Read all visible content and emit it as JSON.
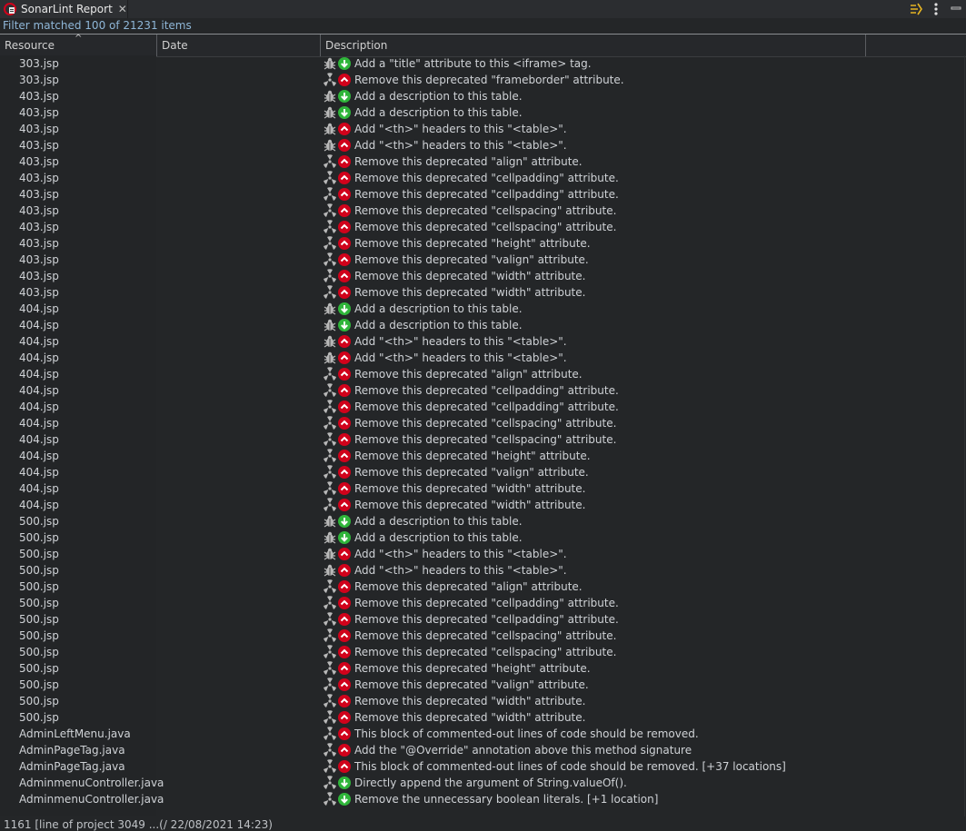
{
  "tab": {
    "title": "SonarLint Report",
    "close_glyph": "✕"
  },
  "toolbar": {
    "filter_icon": "filter-icon",
    "menu_icon": "kebab-menu-icon",
    "minimize_icon": "minimize-icon"
  },
  "filter_summary": "Filter matched 100 of 21231 items",
  "columns": {
    "resource": "Resource",
    "date": "Date",
    "description": "Description"
  },
  "rows": [
    {
      "resource": "303.jsp",
      "severity": "bug",
      "impact": "low",
      "description": "Add a \"title\" attribute to this <iframe> tag."
    },
    {
      "resource": "303.jsp",
      "severity": "code-smell",
      "impact": "high",
      "description": "Remove this deprecated \"frameborder\" attribute."
    },
    {
      "resource": "403.jsp",
      "severity": "bug",
      "impact": "low",
      "description": "Add a description to this table."
    },
    {
      "resource": "403.jsp",
      "severity": "bug",
      "impact": "low",
      "description": "Add a description to this table."
    },
    {
      "resource": "403.jsp",
      "severity": "bug",
      "impact": "high",
      "description": "Add \"<th>\" headers to this \"<table>\"."
    },
    {
      "resource": "403.jsp",
      "severity": "bug",
      "impact": "high",
      "description": "Add \"<th>\" headers to this \"<table>\"."
    },
    {
      "resource": "403.jsp",
      "severity": "code-smell",
      "impact": "high",
      "description": "Remove this deprecated \"align\" attribute."
    },
    {
      "resource": "403.jsp",
      "severity": "code-smell",
      "impact": "high",
      "description": "Remove this deprecated \"cellpadding\" attribute."
    },
    {
      "resource": "403.jsp",
      "severity": "code-smell",
      "impact": "high",
      "description": "Remove this deprecated \"cellpadding\" attribute."
    },
    {
      "resource": "403.jsp",
      "severity": "code-smell",
      "impact": "high",
      "description": "Remove this deprecated \"cellspacing\" attribute."
    },
    {
      "resource": "403.jsp",
      "severity": "code-smell",
      "impact": "high",
      "description": "Remove this deprecated \"cellspacing\" attribute."
    },
    {
      "resource": "403.jsp",
      "severity": "code-smell",
      "impact": "high",
      "description": "Remove this deprecated \"height\" attribute."
    },
    {
      "resource": "403.jsp",
      "severity": "code-smell",
      "impact": "high",
      "description": "Remove this deprecated \"valign\" attribute."
    },
    {
      "resource": "403.jsp",
      "severity": "code-smell",
      "impact": "high",
      "description": "Remove this deprecated \"width\" attribute."
    },
    {
      "resource": "403.jsp",
      "severity": "code-smell",
      "impact": "high",
      "description": "Remove this deprecated \"width\" attribute."
    },
    {
      "resource": "404.jsp",
      "severity": "bug",
      "impact": "low",
      "description": "Add a description to this table."
    },
    {
      "resource": "404.jsp",
      "severity": "bug",
      "impact": "low",
      "description": "Add a description to this table."
    },
    {
      "resource": "404.jsp",
      "severity": "bug",
      "impact": "high",
      "description": "Add \"<th>\" headers to this \"<table>\"."
    },
    {
      "resource": "404.jsp",
      "severity": "bug",
      "impact": "high",
      "description": "Add \"<th>\" headers to this \"<table>\"."
    },
    {
      "resource": "404.jsp",
      "severity": "code-smell",
      "impact": "high",
      "description": "Remove this deprecated \"align\" attribute."
    },
    {
      "resource": "404.jsp",
      "severity": "code-smell",
      "impact": "high",
      "description": "Remove this deprecated \"cellpadding\" attribute."
    },
    {
      "resource": "404.jsp",
      "severity": "code-smell",
      "impact": "high",
      "description": "Remove this deprecated \"cellpadding\" attribute."
    },
    {
      "resource": "404.jsp",
      "severity": "code-smell",
      "impact": "high",
      "description": "Remove this deprecated \"cellspacing\" attribute."
    },
    {
      "resource": "404.jsp",
      "severity": "code-smell",
      "impact": "high",
      "description": "Remove this deprecated \"cellspacing\" attribute."
    },
    {
      "resource": "404.jsp",
      "severity": "code-smell",
      "impact": "high",
      "description": "Remove this deprecated \"height\" attribute."
    },
    {
      "resource": "404.jsp",
      "severity": "code-smell",
      "impact": "high",
      "description": "Remove this deprecated \"valign\" attribute."
    },
    {
      "resource": "404.jsp",
      "severity": "code-smell",
      "impact": "high",
      "description": "Remove this deprecated \"width\" attribute."
    },
    {
      "resource": "404.jsp",
      "severity": "code-smell",
      "impact": "high",
      "description": "Remove this deprecated \"width\" attribute."
    },
    {
      "resource": "500.jsp",
      "severity": "bug",
      "impact": "low",
      "description": "Add a description to this table."
    },
    {
      "resource": "500.jsp",
      "severity": "bug",
      "impact": "low",
      "description": "Add a description to this table."
    },
    {
      "resource": "500.jsp",
      "severity": "bug",
      "impact": "high",
      "description": "Add \"<th>\" headers to this \"<table>\"."
    },
    {
      "resource": "500.jsp",
      "severity": "bug",
      "impact": "high",
      "description": "Add \"<th>\" headers to this \"<table>\"."
    },
    {
      "resource": "500.jsp",
      "severity": "code-smell",
      "impact": "high",
      "description": "Remove this deprecated \"align\" attribute."
    },
    {
      "resource": "500.jsp",
      "severity": "code-smell",
      "impact": "high",
      "description": "Remove this deprecated \"cellpadding\" attribute."
    },
    {
      "resource": "500.jsp",
      "severity": "code-smell",
      "impact": "high",
      "description": "Remove this deprecated \"cellpadding\" attribute."
    },
    {
      "resource": "500.jsp",
      "severity": "code-smell",
      "impact": "high",
      "description": "Remove this deprecated \"cellspacing\" attribute."
    },
    {
      "resource": "500.jsp",
      "severity": "code-smell",
      "impact": "high",
      "description": "Remove this deprecated \"cellspacing\" attribute."
    },
    {
      "resource": "500.jsp",
      "severity": "code-smell",
      "impact": "high",
      "description": "Remove this deprecated \"height\" attribute."
    },
    {
      "resource": "500.jsp",
      "severity": "code-smell",
      "impact": "high",
      "description": "Remove this deprecated \"valign\" attribute."
    },
    {
      "resource": "500.jsp",
      "severity": "code-smell",
      "impact": "high",
      "description": "Remove this deprecated \"width\" attribute."
    },
    {
      "resource": "500.jsp",
      "severity": "code-smell",
      "impact": "high",
      "description": "Remove this deprecated \"width\" attribute."
    },
    {
      "resource": "AdminLeftMenu.java",
      "severity": "code-smell",
      "impact": "high",
      "description": "This block of commented-out lines of code should be removed."
    },
    {
      "resource": "AdminPageTag.java",
      "severity": "code-smell",
      "impact": "high",
      "description": "Add the \"@Override\" annotation above this method signature"
    },
    {
      "resource": "AdminPageTag.java",
      "severity": "code-smell",
      "impact": "high",
      "description": "This block of commented-out lines of code should be removed. [+37 locations]"
    },
    {
      "resource": "AdminmenuController.java",
      "severity": "code-smell",
      "impact": "low",
      "description": "Directly append the argument of String.valueOf()."
    },
    {
      "resource": "AdminmenuController.java",
      "severity": "code-smell",
      "impact": "low",
      "description": "Remove the unnecessary boolean literals. [+1 location]"
    }
  ],
  "status_line": "1161 [line of project 3049 ...(/ 22/08/2021 14:23)",
  "colors": {
    "high": "#d0021b",
    "low": "#2fb53a",
    "accent": "#8fb7d8"
  }
}
